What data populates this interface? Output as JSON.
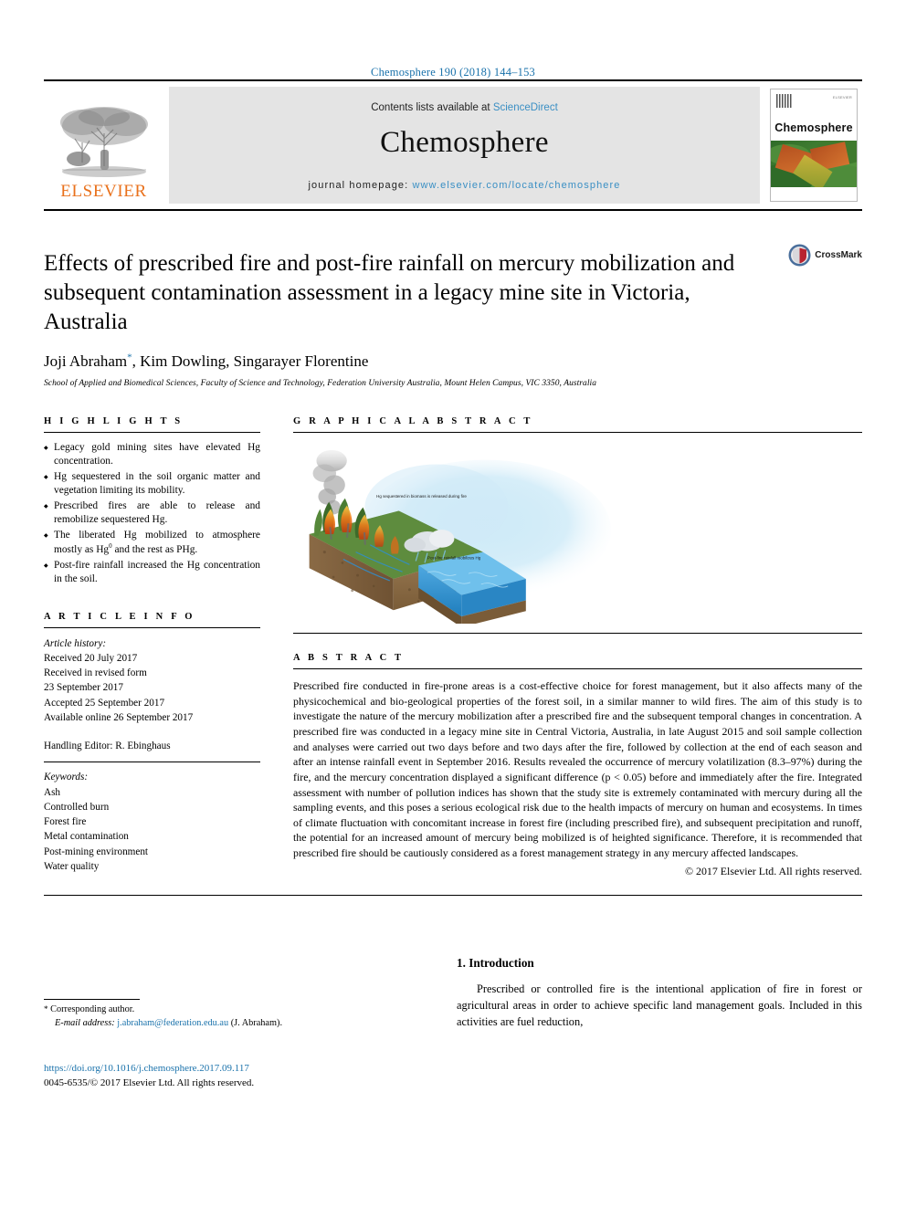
{
  "running_head": "Chemosphere 190 (2018) 144–153",
  "masthead": {
    "publisher_logo_label": "ELSEVIER",
    "contents_prefix": "Contents lists available at",
    "contents_link": "ScienceDirect",
    "journal_name": "Chemosphere",
    "homepage_prefix": "journal homepage:",
    "homepage_url": "www.elsevier.com/locate/chemosphere",
    "cover_title": "Chemosphere",
    "cover_publisher_mini": "ELSEVIER"
  },
  "article": {
    "title": "Effects of prescribed fire and post-fire rainfall on mercury mobilization and subsequent contamination assessment in a legacy mine site in Victoria, Australia",
    "authors": "Joji Abraham, Kim Dowling, Singarayer Florentine",
    "author_marker": "*",
    "affiliation": "School of Applied and Biomedical Sciences, Faculty of Science and Technology, Federation University Australia, Mount Helen Campus, VIC 3350, Australia",
    "crossmark_label": "CrossMark"
  },
  "highlights": {
    "heading": "H I G H L I G H T S",
    "items": [
      "Legacy gold mining sites have elevated Hg concentration.",
      "Hg sequestered in the soil organic matter and vegetation limiting its mobility.",
      "Prescribed fires are able to release and remobilize sequestered Hg.",
      "The liberated Hg mobilized to atmosphere mostly as Hg0 and the rest as PHg.",
      "Post-fire rainfall increased the Hg concentration in the soil."
    ]
  },
  "graphical_abstract": {
    "heading": "G R A P H I C A L   A B S T R A C T",
    "caption_upper": "Hg sequestered in biomass is released during fire",
    "caption_lower": "Post-fire rainfall mobilizes Hg"
  },
  "article_info": {
    "heading": "A R T I C L E   I N F O",
    "history_label": "Article history:",
    "received": "Received 20 July 2017",
    "revised_label": "Received in revised form",
    "revised_date": "23 September 2017",
    "accepted": "Accepted 25 September 2017",
    "available": "Available online 26 September 2017",
    "handling_editor": "Handling Editor: R. Ebinghaus",
    "keywords_label": "Keywords:",
    "keywords": [
      "Ash",
      "Controlled burn",
      "Forest fire",
      "Metal contamination",
      "Post-mining environment",
      "Water quality"
    ]
  },
  "abstract": {
    "heading": "A B S T R A C T",
    "text": "Prescribed fire conducted in fire-prone areas is a cost-effective choice for forest management, but it also affects many of the physicochemical and bio-geological properties of the forest soil, in a similar manner to wild fires. The aim of this study is to investigate the nature of the mercury mobilization after a prescribed fire and the subsequent temporal changes in concentration. A prescribed fire was conducted in a legacy mine site in Central Victoria, Australia, in late August 2015 and soil sample collection and analyses were carried out two days before and two days after the fire, followed by collection at the end of each season and after an intense rainfall event in September 2016. Results revealed the occurrence of mercury volatilization (8.3–97%) during the fire, and the mercury concentration displayed a significant difference (p < 0.05) before and immediately after the fire. Integrated assessment with number of pollution indices has shown that the study site is extremely contaminated with mercury during all the sampling events, and this poses a serious ecological risk due to the health impacts of mercury on human and ecosystems. In times of climate fluctuation with concomitant increase in forest fire (including prescribed fire), and subsequent precipitation and runoff, the potential for an increased amount of mercury being mobilized is of heighted significance. Therefore, it is recommended that prescribed fire should be cautiously considered as a forest management strategy in any mercury affected landscapes.",
    "copyright": "© 2017 Elsevier Ltd. All rights reserved."
  },
  "introduction": {
    "number_title": "1. Introduction",
    "paragraph": "Prescribed or controlled fire is the intentional application of fire in forest or agricultural areas in order to achieve specific land management goals. Included in this activities are fuel reduction,"
  },
  "footer": {
    "corresponding_star": "*",
    "corresponding_label": "Corresponding author.",
    "email_label": "E-mail address:",
    "email": "j.abraham@federation.edu.au",
    "email_suffix": "(J. Abraham).",
    "doi": "https://doi.org/10.1016/j.chemosphere.2017.09.117",
    "issn_line": "0045-6535/© 2017 Elsevier Ltd. All rights reserved."
  },
  "colors": {
    "link": "#1a72ab",
    "elsevier_orange": "#E9711C",
    "sciencedirect_blue": "#3a8fc4",
    "band_gray": "#e4e4e4"
  }
}
